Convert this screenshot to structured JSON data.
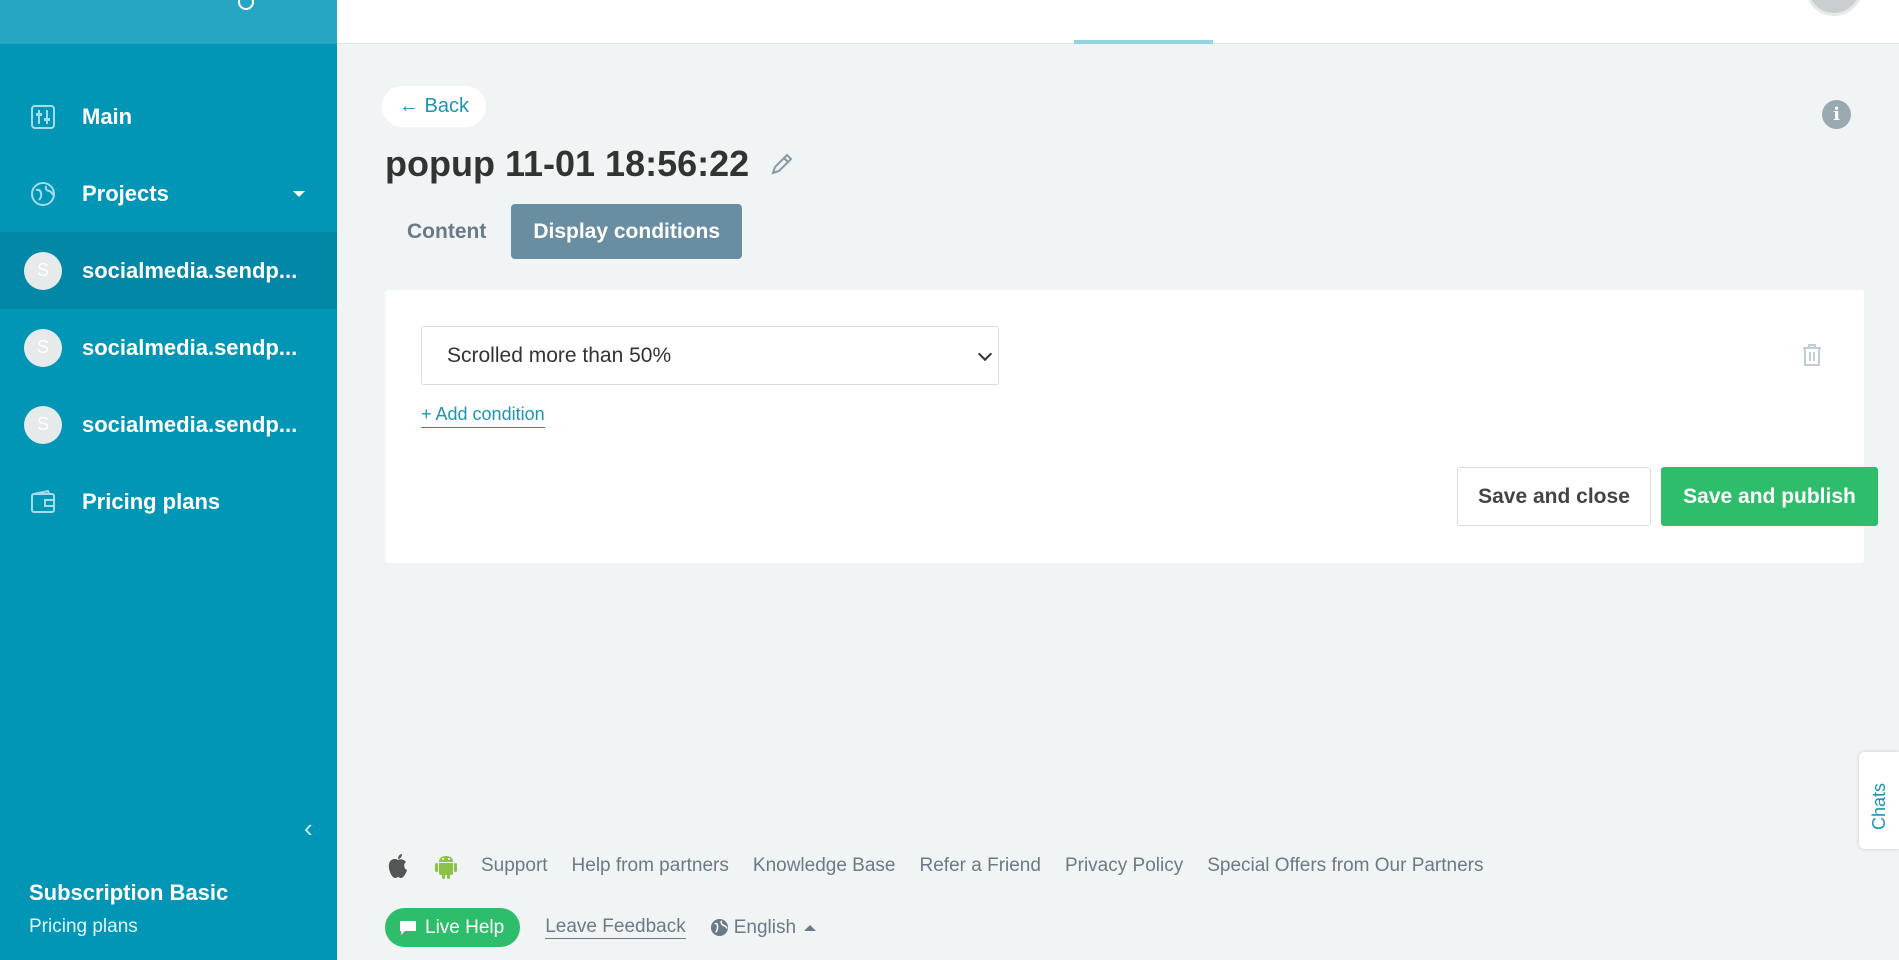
{
  "sidebar": {
    "items": [
      {
        "label": "Main",
        "icon": "sliders-icon"
      },
      {
        "label": "Projects",
        "icon": "globe-icon"
      },
      {
        "label": "socialmedia.sendp...",
        "avatar": "S"
      },
      {
        "label": "socialmedia.sendp...",
        "avatar": "S"
      },
      {
        "label": "socialmedia.sendp...",
        "avatar": "S"
      },
      {
        "label": "Pricing plans",
        "icon": "wallet-icon"
      }
    ],
    "collapse_glyph": "‹",
    "subscription": {
      "title": "Subscription Basic",
      "link": "Pricing plans"
    }
  },
  "main": {
    "back_label": "← Back",
    "title": "popup 11-01 18:56:22",
    "info_glyph": "i",
    "tabs": [
      {
        "label": "Content",
        "active": false
      },
      {
        "label": "Display conditions",
        "active": true
      }
    ],
    "condition": {
      "selected": "Scrolled more than 50%"
    },
    "add_condition_label": "+ Add condition",
    "save_close_label": "Save and close",
    "save_publish_label": "Save and publish"
  },
  "chats_label": "Chats",
  "footer": {
    "links": [
      "Support",
      "Help from partners",
      "Knowledge Base",
      "Refer a Friend",
      "Privacy Policy",
      "Special Offers from Our Partners"
    ],
    "live_help_label": "Live Help",
    "feedback_label": "Leave Feedback",
    "language": "English"
  },
  "colors": {
    "sidebar": "#0296b6",
    "accent": "#1c95b3",
    "primary_button": "#2ebd6b",
    "active_tab": "#6a8ea1"
  }
}
